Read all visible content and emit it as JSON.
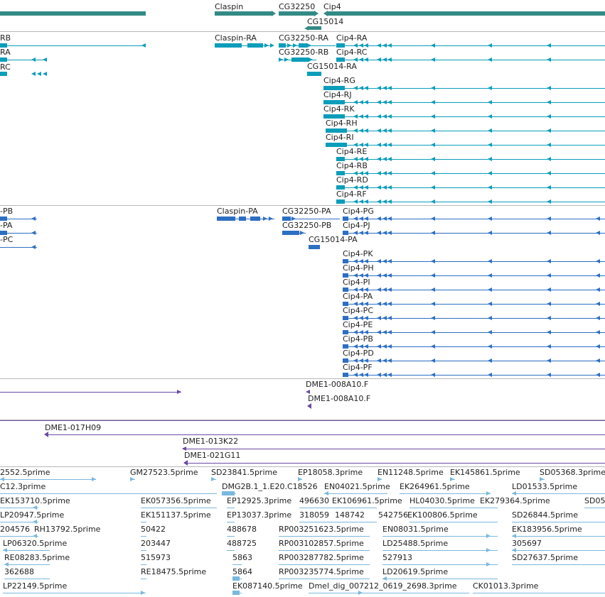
{
  "colors": {
    "gene": "#338a85",
    "tx": "#0b9dba",
    "cds": "#2c6fc3",
    "clone": "#6a4aa5",
    "est": "#7ab8de",
    "separator": "#b8b8b8"
  },
  "gene_track": {
    "labels": [
      "Claspin",
      "CG32250",
      "Cip4",
      "CG15014"
    ]
  },
  "transcript_track": {
    "labels": [
      "RB",
      "RA",
      "RC",
      "Claspin-RA",
      "CG32250-RA",
      "Cip4-RA",
      "CG32250-RB",
      "Cip4-RC",
      "CG15014-RA",
      "Cip4-RG",
      "Cip4-RJ",
      "Cip4-RK",
      "Cip4-RH",
      "Cip4-RI",
      "Cip4-RE",
      "Cip4-RB",
      "Cip4-RD",
      "Cip4-RF"
    ]
  },
  "protein_track": {
    "labels": [
      "-PB",
      "-PA",
      "-PC",
      "Claspin-PA",
      "CG32250-PA",
      "Cip4-PG",
      "CG32250-PB",
      "Cip4-PJ",
      "CG15014-PA",
      "Cip4-PK",
      "Cip4-PH",
      "Cip4-PI",
      "Cip4-PA",
      "Cip4-PC",
      "Cip4-PE",
      "Cip4-PB",
      "Cip4-PD",
      "Cip4-PF"
    ]
  },
  "clone_track": {
    "labels": [
      "DME1-008A10.F",
      "DME1-008A10.F"
    ]
  },
  "bac_track": {
    "labels": [
      "DME1-017H09",
      "DME1-013K22",
      "DME1-021G11"
    ]
  },
  "est_track": {
    "labels": [
      "2552.5prime",
      "GM27523.5prime",
      "SD23841.5prime",
      "EP18058.3prime",
      "EN11248.5prime",
      "EK145861.5prime",
      "SD05368.3prime",
      "C12.3prime",
      "DMG2B.1_1.E20.C18526",
      "EN04021.5prime",
      "EK264961.5prime",
      "LD01533.5prime",
      "EK153710.5prime",
      "EK057356.5prime",
      "EP12925.3prime",
      "496630",
      "EK106961.5prime",
      "HL04030.5prime",
      "EK279364.5prime",
      "SD05",
      "LP20947.5prime",
      "EK151137.5prime",
      "EP13037.3prime",
      "318059",
      "148742",
      "542756",
      "EK100806.5prime",
      "SD26844.5prime",
      "204576",
      "RH13792.5prime",
      "50422",
      "488678",
      "RP003251623.5prime",
      "EN08031.5prime",
      "EK183956.5prime",
      "LP06320.5prime",
      "203447",
      "488725",
      "RP003102857.5prime",
      "LD25488.5prime",
      "305697",
      "RE08283.5prime",
      "515973",
      "5863",
      "RP003287782.5prime",
      "527913",
      "SD27637.5prime",
      "362688",
      "RE18475.5prime",
      "5864",
      "RP003235774.5prime",
      "LD20619.5prime",
      "LP22149.5prime",
      "EK087140.5prime",
      "Dmel_dig_007212_0619_2698.3prime",
      "CK01013.3prime"
    ]
  }
}
